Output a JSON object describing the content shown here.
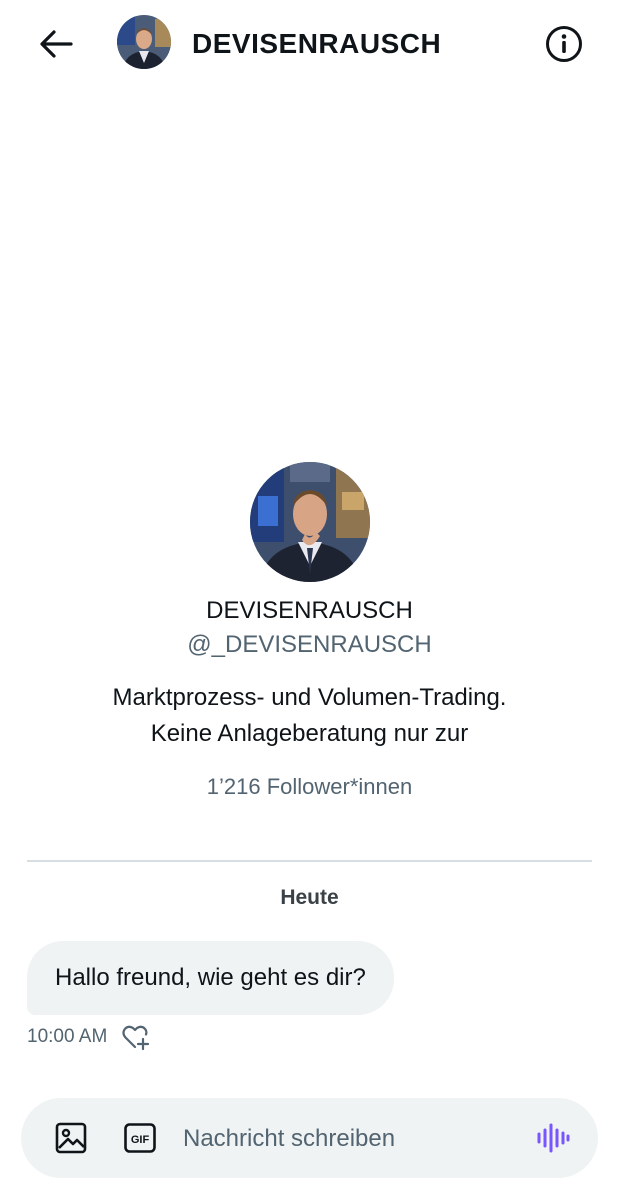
{
  "header": {
    "title": "DEVISENRAUSCH",
    "back_icon": "arrow-left-icon",
    "info_icon": "info-circle-icon"
  },
  "profile": {
    "display_name": "DEVISENRAUSCH",
    "handle": "@_DEVISENRAUSCH",
    "bio_line1": "Marktprozess- und Volumen-Trading.",
    "bio_line2": "Keine Anlageberatung nur zur",
    "followers": "1’216 Follower*innen"
  },
  "conversation": {
    "day_label": "Heute",
    "messages": [
      {
        "text": "Hallo freund, wie geht es dir?",
        "time": "10:00 AM"
      }
    ]
  },
  "composer": {
    "placeholder": "Nachricht schreiben",
    "gif_label": "GIF",
    "image_icon": "image-icon",
    "voice_icon": "voice-wave-icon"
  },
  "colors": {
    "text_primary": "#0f1419",
    "text_secondary": "#536471",
    "bubble_bg": "#eff3f4",
    "accent_voice": "#7856ff",
    "divider": "#d8dde2"
  }
}
